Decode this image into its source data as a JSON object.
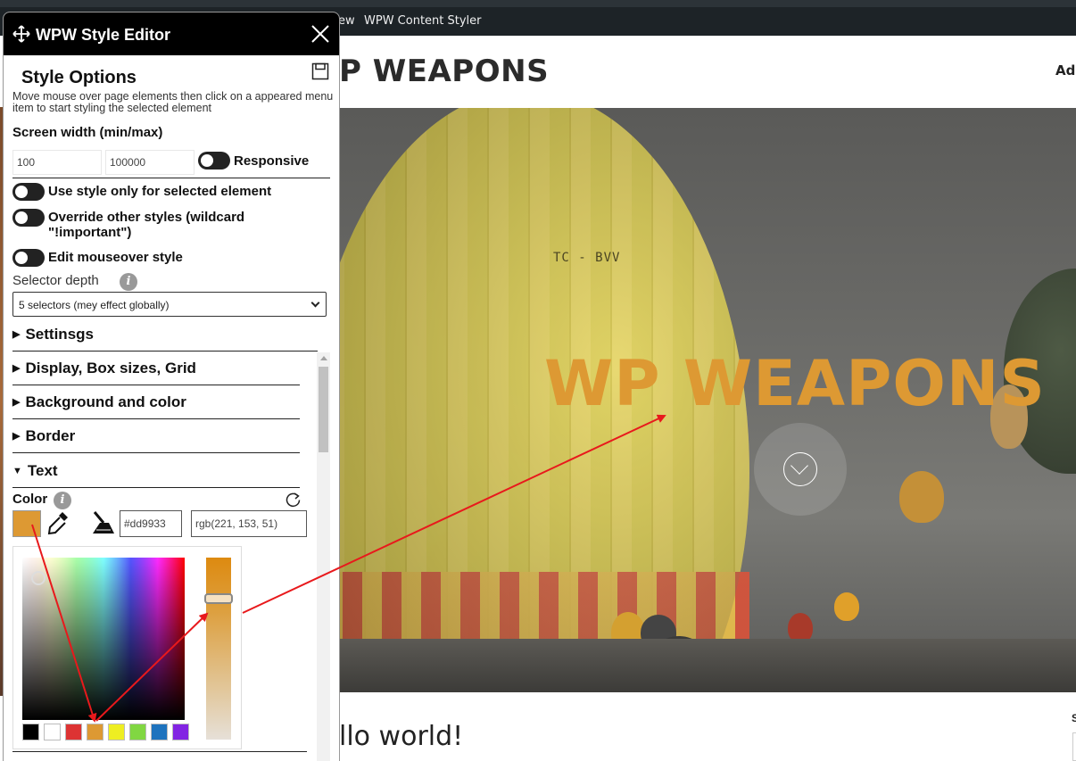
{
  "adminbar": {
    "partial_item": "ew",
    "plugin_item": "WPW Content Styler"
  },
  "site": {
    "title_partial": "P WEAPONS",
    "nav_partial": "Ad",
    "hero_title": "WP WEAPONS",
    "hero_balloon_text": "TC - BVV",
    "post_title_partial": "llo world!",
    "side_widget_partial": "S"
  },
  "editor": {
    "title": "WPW Style Editor",
    "section_title": "Style Options",
    "hint": "Move mouse over page elements then click on a appeared menu item to start styling the selected element",
    "screen_width_label": "Screen width (min/max)",
    "min_width": "100",
    "max_width": "100000",
    "responsive_label": "Responsive",
    "only_selected_label": "Use style only for selected element",
    "override_label_1": "Override other styles (wildcard",
    "override_label_2": "\"!important\")",
    "mouseover_label": "Edit mouseover style",
    "selector_depth_label": "Selector depth",
    "selector_depth_value": "5 selectors (mey effect globally)",
    "accordions": {
      "settings": "Settinsgs",
      "display": "Display, Box sizes, Grid",
      "background": "Background and color",
      "border": "Border",
      "text": "Text"
    },
    "color_label": "Color",
    "hex_value": "#dd9933",
    "rgb_value": "rgb(221, 153, 51)",
    "current_color": "#dd9933",
    "palette": [
      "#000000",
      "#ffffff",
      "#dd3333",
      "#dd9933",
      "#eeee22",
      "#81d742",
      "#1e73be",
      "#8224e3"
    ]
  },
  "annotation_color": "#e8191c"
}
